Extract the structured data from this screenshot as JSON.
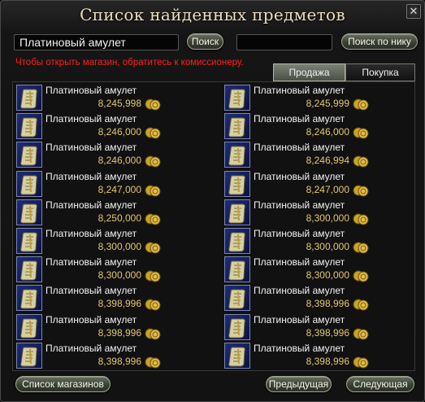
{
  "window": {
    "title": "Список найденных предметов",
    "close_glyph": "✕"
  },
  "search": {
    "item_query": "Платиновый амулет",
    "search_button": "Поиск",
    "nick_query": "",
    "nick_button": "Поиск по нику"
  },
  "notice": "Чтобы открыть магазин, обратитесь к комиссионеру.",
  "tabs": [
    {
      "label": "Продажа",
      "active": true
    },
    {
      "label": "Покупка",
      "active": false
    }
  ],
  "colors": {
    "notice": "#ff2020",
    "price": "#e2c870",
    "title": "#eadfbd"
  },
  "icons": {
    "item": "scroll-icon",
    "currency": "coins-icon"
  },
  "items_left": [
    {
      "name": "Платиновый амулет",
      "price": "8,245,998"
    },
    {
      "name": "Платиновый амулет",
      "price": "8,246,000"
    },
    {
      "name": "Платиновый амулет",
      "price": "8,246,000"
    },
    {
      "name": "Платиновый амулет",
      "price": "8,247,000"
    },
    {
      "name": "Платиновый амулет",
      "price": "8,250,000"
    },
    {
      "name": "Платиновый амулет",
      "price": "8,300,000"
    },
    {
      "name": "Платиновый амулет",
      "price": "8,300,000"
    },
    {
      "name": "Платиновый амулет",
      "price": "8,398,996"
    },
    {
      "name": "Платиновый амулет",
      "price": "8,398,996"
    },
    {
      "name": "Платиновый амулет",
      "price": "8,398,996"
    }
  ],
  "items_right": [
    {
      "name": "Платиновый амулет",
      "price": "8,245,999"
    },
    {
      "name": "Платиновый амулет",
      "price": "8,246,000"
    },
    {
      "name": "Платиновый амулет",
      "price": "8,246,994"
    },
    {
      "name": "Платиновый амулет",
      "price": "8,247,000"
    },
    {
      "name": "Платиновый амулет",
      "price": "8,300,000"
    },
    {
      "name": "Платиновый амулет",
      "price": "8,300,000"
    },
    {
      "name": "Платиновый амулет",
      "price": "8,300,000"
    },
    {
      "name": "Платиновый амулет",
      "price": "8,398,996"
    },
    {
      "name": "Платиновый амулет",
      "price": "8,398,996"
    },
    {
      "name": "Платиновый амулет",
      "price": "8,398,996"
    }
  ],
  "footer": {
    "shops_button": "Список магазинов",
    "prev_button": "Предыдущая",
    "next_button": "Следующая"
  }
}
